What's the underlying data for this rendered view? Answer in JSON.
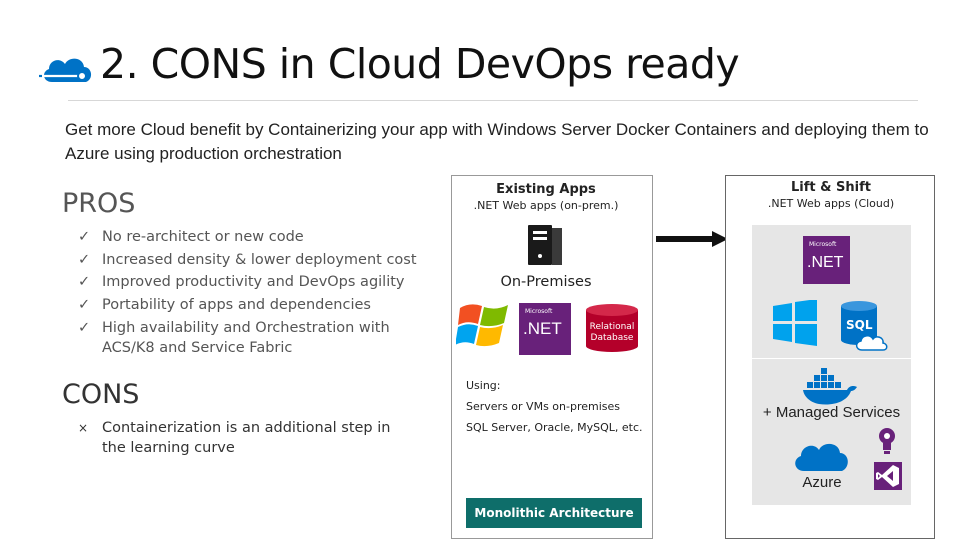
{
  "slide": {
    "title": "2. CONS in Cloud DevOps ready",
    "subtitle": "Get more Cloud benefit by Containerizing  your app with Windows Server Docker Containers and deploying them to Azure using production orchestration"
  },
  "pros": {
    "heading": "PROS",
    "mark": "✓",
    "items": [
      "No re-architect or new code",
      "Increased density & lower deployment cost",
      "Improved productivity and DevOps agility",
      "Portability of apps and dependencies",
      "High availability and Orchestration with ACS/K8 and Service Fabric"
    ]
  },
  "cons": {
    "heading": "CONS",
    "mark": "×",
    "items": [
      "Containerization is an additional step in the learning curve"
    ]
  },
  "existing_apps": {
    "title": "Existing Apps",
    "subtitle": ".NET Web apps (on-prem.)",
    "location": "On-Premises",
    "net_logo_small": "Microsoft",
    "net_logo_text": ".NET",
    "db_label_line1": "Relational",
    "db_label_line2": "Database",
    "using_label": "Using:",
    "using_items": [
      "Servers or VMs on-premises",
      "SQL Server, Oracle, MySQL, etc."
    ],
    "architecture_label": "Monolithic Architecture"
  },
  "lift_shift": {
    "title": "Lift & Shift",
    "subtitle": ".NET Web apps (Cloud)",
    "net_logo_small": "Microsoft",
    "net_logo_text": ".NET",
    "sql_label": "SQL",
    "managed_services_label": "+ Managed Services",
    "azure_label": "Azure"
  },
  "colors": {
    "dotnet_purple": "#68217a",
    "windows_blue": "#00a2ed",
    "azure_blue": "#0072c6",
    "database_red": "#b4002a",
    "monolithic_teal": "#0e6e6a",
    "panel_gray": "#e6e6e6"
  },
  "icons": [
    "cloud-icon",
    "server-tower-icon",
    "windows-logo-icon",
    "dotnet-logo-icon",
    "database-icon",
    "arrow-right-icon",
    "windows-tiles-icon",
    "sql-database-icon",
    "docker-whale-icon",
    "lightbulb-icon",
    "visual-studio-icon",
    "azure-cloud-icon"
  ]
}
